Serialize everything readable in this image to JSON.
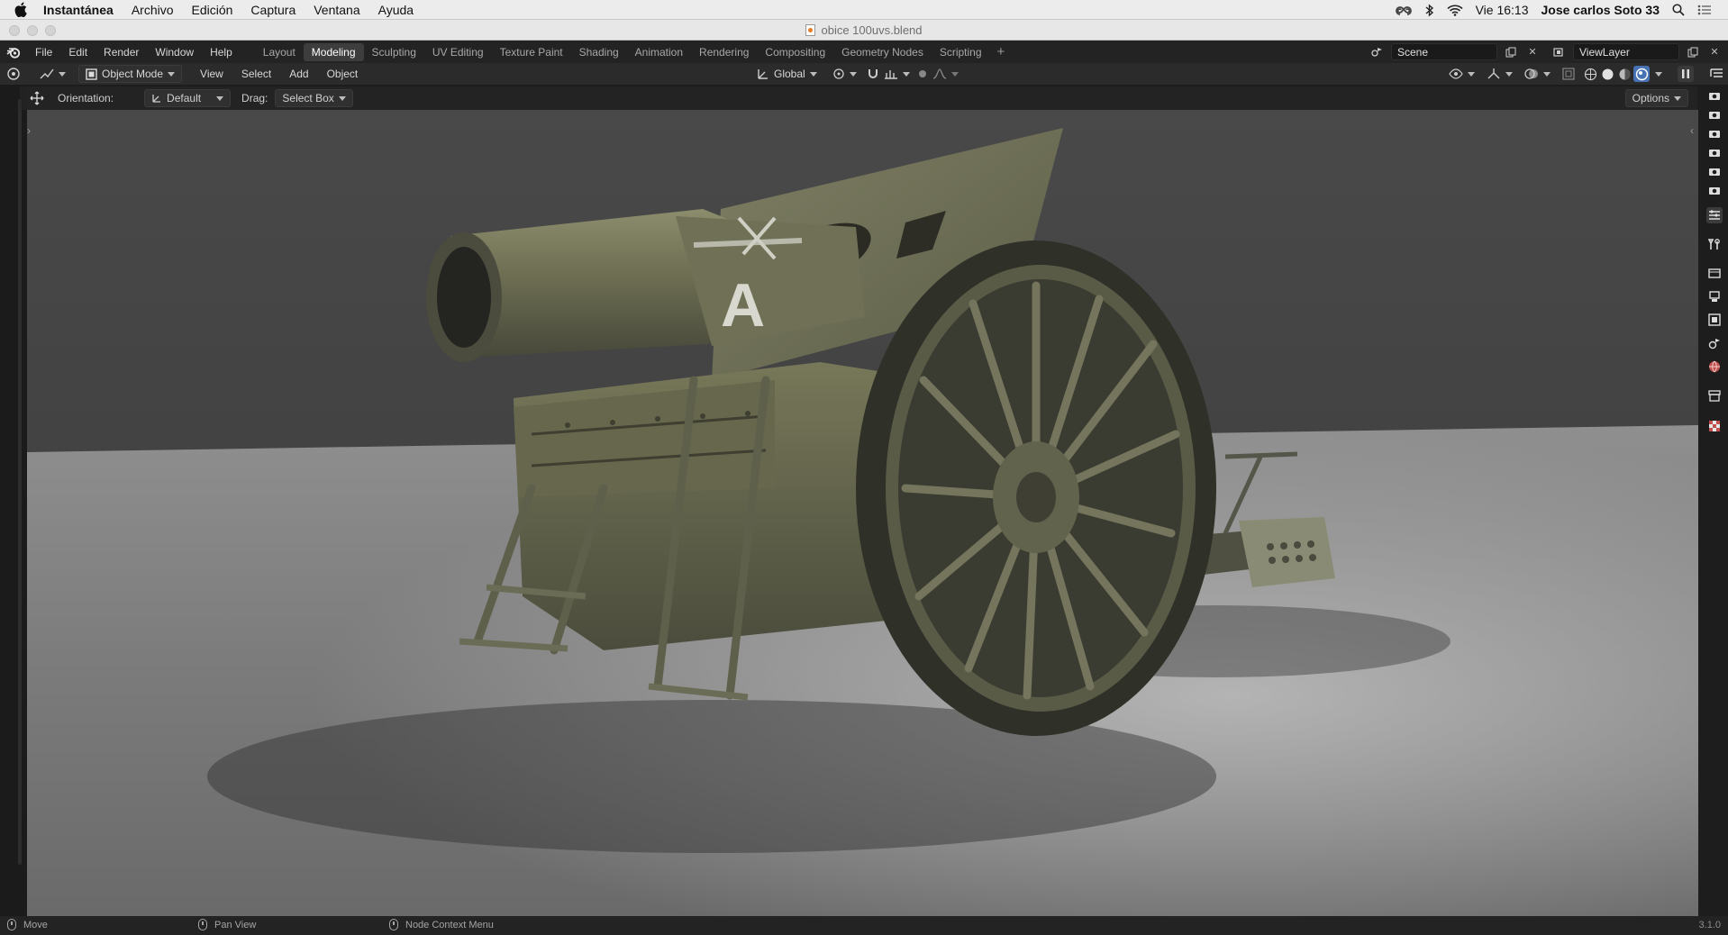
{
  "macos_menubar": {
    "app_name": "Instantánea",
    "menus": [
      "Archivo",
      "Edición",
      "Captura",
      "Ventana",
      "Ayuda"
    ],
    "clock": "Vie 16:13",
    "user": "Jose carlos Soto 33",
    "status_icons": [
      "creative-cloud-icon",
      "bluetooth-icon",
      "wifi-icon",
      "spotlight-search-icon",
      "notification-center-icon"
    ]
  },
  "window": {
    "title": "obice 100uvs.blend"
  },
  "blender_topbar": {
    "menus": [
      "File",
      "Edit",
      "Render",
      "Window",
      "Help"
    ],
    "workspaces": [
      "Layout",
      "Modeling",
      "Sculpting",
      "UV Editing",
      "Texture Paint",
      "Shading",
      "Animation",
      "Rendering",
      "Compositing",
      "Geometry Nodes",
      "Scripting"
    ],
    "active_workspace": "Modeling",
    "add_workspace_label": "+",
    "scene_name": "Scene",
    "view_layer_name": "ViewLayer"
  },
  "viewport_header": {
    "mode": "Object Mode",
    "menus": [
      "View",
      "Select",
      "Add",
      "Object"
    ],
    "transform_orientation": "Global"
  },
  "tool_settings": {
    "orientation_label": "Orientation:",
    "orientation_value": "Default",
    "drag_label": "Drag:",
    "drag_value": "Select Box",
    "options_label": "Options"
  },
  "viewport_scene": {
    "object": "artillery-howitzer-model",
    "barrel_letter": "A",
    "colors": {
      "background_top": "#454545",
      "floor_light": "#a3a3a3",
      "metal": "#6a6b4e",
      "wheel_dark": "#35362b"
    }
  },
  "statusbar": {
    "items": [
      "Move",
      "Pan View",
      "Node Context Menu"
    ],
    "version": "3.1.0"
  },
  "colors": {
    "active_tab_bg": "#3d3d3d",
    "ui_dark": "#232323",
    "accent_blue": "#4772b3"
  }
}
